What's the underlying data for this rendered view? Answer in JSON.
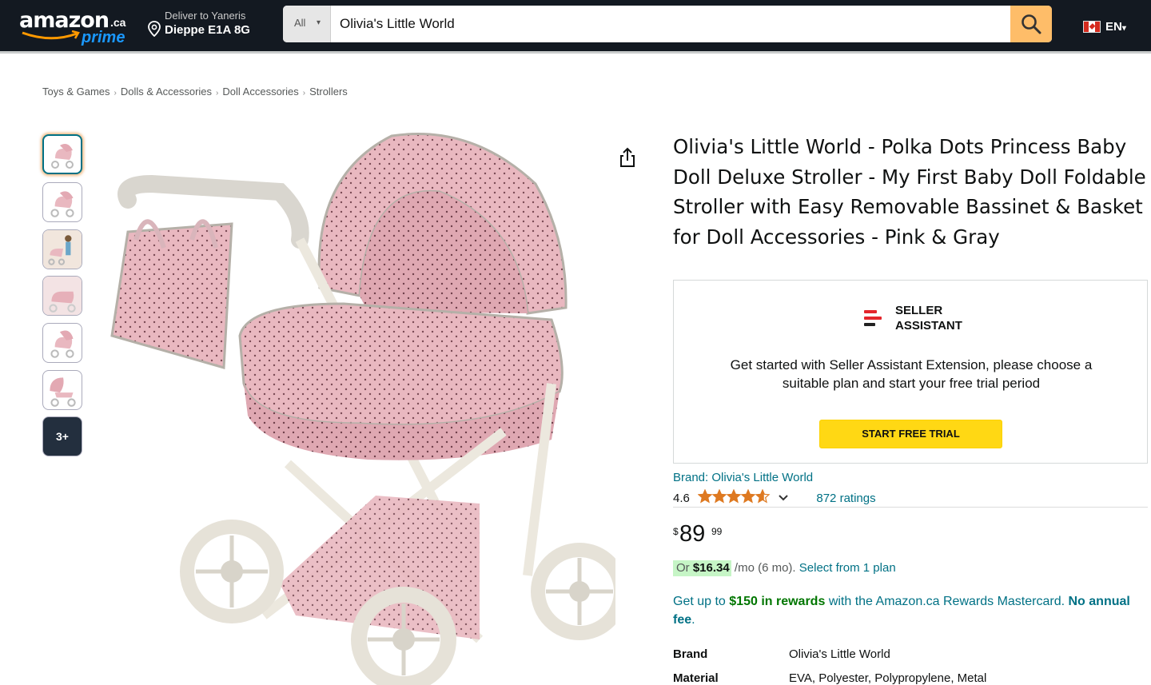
{
  "header": {
    "logo_word": "amazon",
    "logo_tld": ".ca",
    "logo_sub": "prime",
    "deliver_line1": "Deliver to Yaneris",
    "deliver_line2": "Dieppe E1A 8G",
    "search_category": "All",
    "search_value": "Olivia's Little World",
    "language": "EN"
  },
  "breadcrumb": [
    "Toys & Games",
    "Dolls & Accessories",
    "Doll Accessories",
    "Strollers"
  ],
  "thumbnails": {
    "count": 6,
    "more_label": "3+"
  },
  "product": {
    "title": "Olivia's Little World - Polka Dots Princess Baby Doll Deluxe Stroller - My First Baby Doll Foldable Stroller with Easy Removable Bassinet & Basket for Doll Accessories - Pink & Gray",
    "brand_line": "Brand: Olivia's Little World",
    "rating_value": "4.6",
    "rating_stars": 4.6,
    "ratings_count": "872 ratings",
    "price_symbol": "$",
    "price_whole": "89",
    "price_fraction": "99",
    "monthly_prefix": "Or",
    "monthly_amount": "$16.34",
    "monthly_suffix": "/mo (6 mo).",
    "monthly_link": "Select from 1 plan",
    "rewards_pre": "Get up to",
    "rewards_amount": "$150 in rewards",
    "rewards_mid": "with the Amazon.ca Rewards Mastercard.",
    "rewards_bold": "No annual fee",
    "rewards_end": ".",
    "specs": [
      {
        "key": "Brand",
        "value": "Olivia's Little World"
      },
      {
        "key": "Material",
        "value": "EVA, Polyester, Polypropylene, Metal"
      }
    ]
  },
  "seller_assistant": {
    "name_line1": "SELLER",
    "name_line2": "ASSISTANT",
    "message": "Get started with Seller Assistant Extension, please choose a suitable plan and start your free trial period",
    "cta": "START FREE TRIAL"
  },
  "colors": {
    "nav_bg": "#131921",
    "search_btn": "#febd69",
    "link": "#007185",
    "cta_yellow": "#ffd814",
    "star": "#de7921",
    "stroller_pink": "#e9b8c0"
  }
}
